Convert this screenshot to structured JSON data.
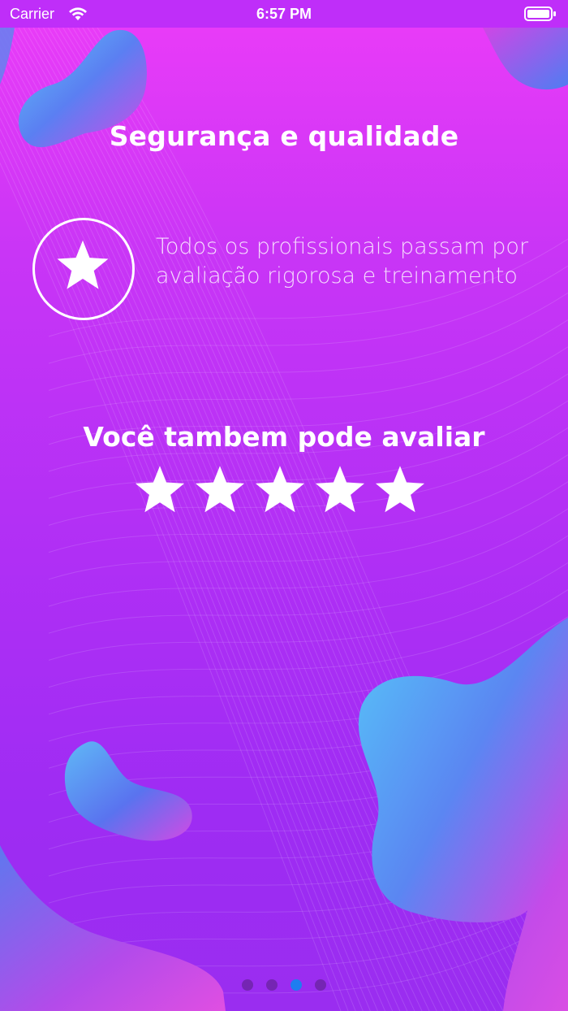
{
  "status_bar": {
    "carrier": "Carrier",
    "time": "6:57 PM"
  },
  "onboarding": {
    "title": "Segurança e qualidade",
    "feature": {
      "icon": "star-icon",
      "description_line1": "Todos os profissionais passam por",
      "description_line2": "avaliação rigorosa e treinamento"
    },
    "rating": {
      "title": "Você tambem pode avaliar",
      "max_stars": 5,
      "star_icon": "star-icon"
    },
    "page_indicator": {
      "total": 4,
      "current": 3
    }
  },
  "colors": {
    "background_top": "#ec3cf8",
    "background_bottom": "#9a2df0",
    "active_dot": "#1e7df0",
    "inactive_dot": "#6f24a8"
  }
}
